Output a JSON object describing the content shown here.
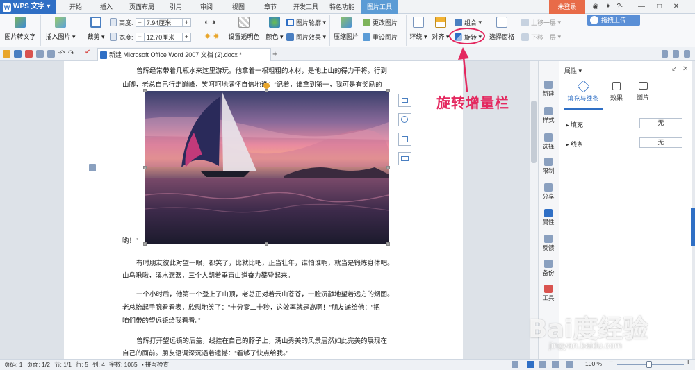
{
  "app": {
    "name": "WPS 文字",
    "logo": "W"
  },
  "menu_tabs": [
    "开始",
    "插入",
    "页面布局",
    "引用",
    "审阅",
    "视图",
    "章节",
    "开发工具",
    "特色功能",
    "图片工具"
  ],
  "active_tab": "图片工具",
  "login_label": "未登录",
  "window_controls": {
    "help": "?·",
    "minimize": "—",
    "maximize": "□",
    "close": "✕"
  },
  "upload_label": "拖拽上传",
  "ribbon": {
    "image_to_text": "图片转文字",
    "insert_image": "插入图片",
    "crop": "裁剪",
    "height_label": "高度:",
    "height_value": "7.94厘米",
    "width_label": "宽度:",
    "width_value": "12.70厘米",
    "minus": "−",
    "plus": "+",
    "set_transparent": "设置透明色",
    "color": "颜色",
    "image_outline": "图片轮廓",
    "image_effect": "图片效果",
    "compress": "压缩图片",
    "change_image": "更改图片",
    "reset_image": "重设图片",
    "wrap": "环绕",
    "align": "对齐",
    "group": "组合",
    "rotate": "旋转",
    "selection_pane": "选择窗格",
    "bring_forward": "上移一层",
    "send_backward": "下移一层"
  },
  "document_tab": "新建 Microsoft Office Word 2007 文档 (2).docx *",
  "new_tab_symbol": "+",
  "paragraphs": {
    "p1_line1": "曾辉经常带着几瓶水来这里游玩。他拿着一根粗粗的木材，是他上山的得力干将。行到",
    "p1_line2": "山脚，老总自己行走巅峰，笑呵呵地满怀自信地说：“记着，谁拿到第一，我可是有奖励的",
    "p1_end": "哟！”",
    "p2_line1": "有时朋友彼此对望一眼，都笑了，比就比吧，正当壮年，谁怕谁啊，就当是锻炼身体吧。",
    "p2_line2": "山鸟啾啾，溪水潺潺，三个人朝着垂直山道奋力攀登起来。",
    "p3_line1": "一个小时后，他第一个登上了山顶，老总正对着云山苍苍，一脸沉静地望着远方的烟图。",
    "p3_line2": "老总抬起手腕看看表，欣慰地笑了：“十分零二十秒，这效率就是高啊！”朋友递给他：“把",
    "p3_line3": "咱们带的望远镜给我看看。”",
    "p4_line1": "曾辉打开望远镜的后盖，线挂在自己的脖子上，满山秀美的风景居然如此完美的展现在",
    "p4_line2": "自己的面前。朋友语调深沉透着遗憾：“看够了快点给我。”"
  },
  "annotation": "旋转增量栏",
  "rail": [
    "新建",
    "样式",
    "选择",
    "限制",
    "分享",
    "属性",
    "反馈",
    "备份",
    "工具"
  ],
  "panel": {
    "title": "属性",
    "tabs": [
      "填充与线条",
      "效果",
      "图片"
    ],
    "fill_label": "填充",
    "fill_value": "无",
    "line_label": "线条",
    "line_value": "无"
  },
  "status": {
    "page_num": "页码: 1",
    "pages": "页面: 1/2",
    "section": "节: 1/1",
    "row": "行: 5",
    "col": "列: 4",
    "words": "字数: 1065",
    "spell": "拼写检查",
    "zoom": "100 %"
  },
  "watermark": {
    "main": "Bai度经验",
    "sub": "jingyan.baidu.com"
  },
  "colors": {
    "accent": "#2f6fc5",
    "annotation": "#e4285f",
    "login": "#e86b48"
  }
}
